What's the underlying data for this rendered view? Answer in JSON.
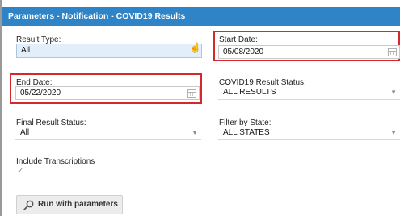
{
  "header": {
    "title": "Parameters - Notification - COVID19 Results"
  },
  "result_type": {
    "label": "Result Type:",
    "value": "All"
  },
  "start_date": {
    "label": "Start Date:",
    "value": "05/08/2020"
  },
  "end_date": {
    "label": "End Date:",
    "value": "05/22/2020"
  },
  "covid_status": {
    "label": "COVID19 Result Status:",
    "value": "ALL RESULTS"
  },
  "final_status": {
    "label": "Final Result Status:",
    "value": "All"
  },
  "state_filter": {
    "label": "Filter by State:",
    "value": "ALL STATES"
  },
  "include_transcriptions": {
    "label": "Include Transcriptions",
    "checked": true
  },
  "run_button": {
    "label": "Run with parameters",
    "icon": "search-icon"
  },
  "colors": {
    "header": "#2e84c6",
    "highlight": "#d5282e",
    "selected_field": "#e2eef9"
  },
  "icons": {
    "check": "✓",
    "chevron": "▼",
    "hand_cursor": "☝"
  }
}
